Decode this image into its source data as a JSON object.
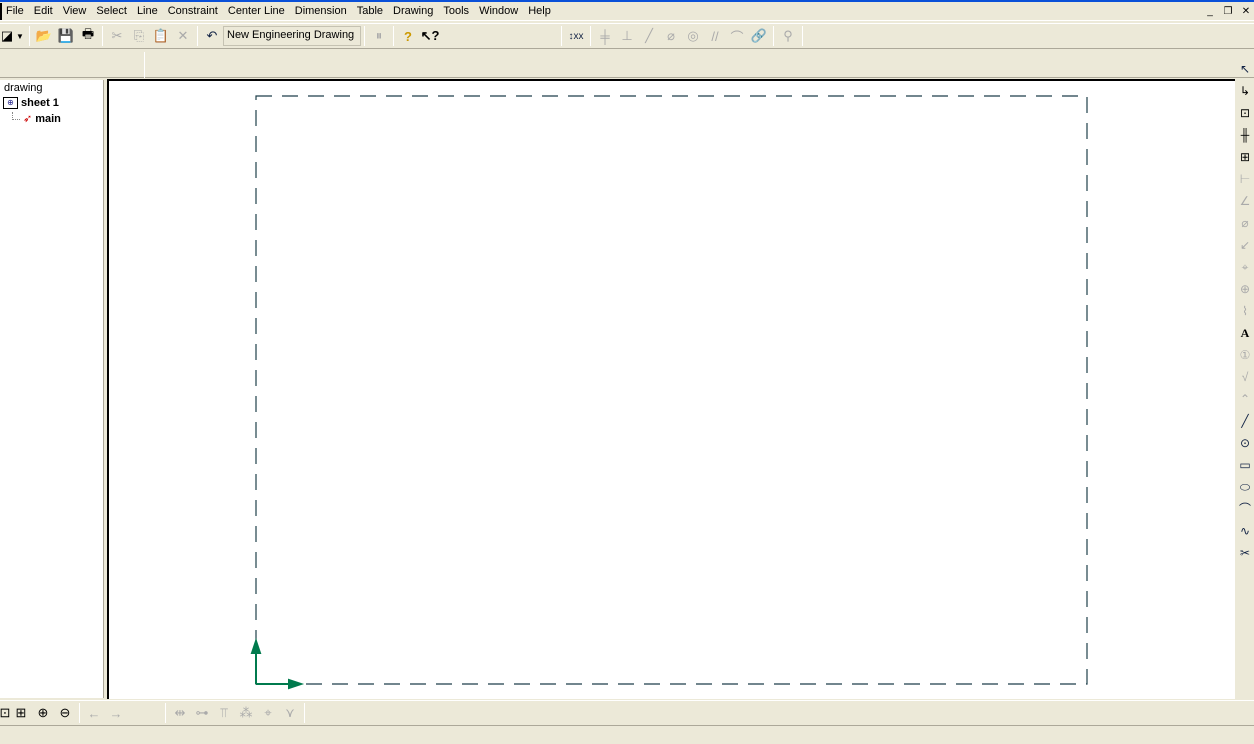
{
  "menu": [
    "File",
    "Edit",
    "View",
    "Select",
    "Line",
    "Constraint",
    "Center Line",
    "Dimension",
    "Table",
    "Drawing",
    "Tools",
    "Window",
    "Help"
  ],
  "toolbar": {
    "drawing_name": "New Engineering Drawing"
  },
  "tree": {
    "root": "drawing",
    "sheet": "sheet 1",
    "view": "main"
  },
  "colors": {
    "axis": "#007a4d",
    "frame": "#1f3f4a",
    "accent": "#0a50d8"
  }
}
